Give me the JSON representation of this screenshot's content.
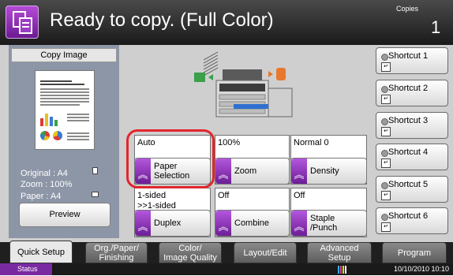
{
  "header": {
    "title": "Ready to copy. (Full Color)",
    "copies_label": "Copies",
    "copies_value": "1"
  },
  "preview_panel": {
    "title": "Copy Image",
    "original": "Original  :  A4",
    "zoom": "Zoom      :  100%",
    "paper": "Paper     :  A4",
    "preview_label": "Preview"
  },
  "functions": {
    "paper_selection": {
      "value": "Auto",
      "label": "Paper Selection"
    },
    "zoom": {
      "value": "100%",
      "label": "Zoom"
    },
    "density": {
      "value": "Normal 0",
      "label": "Density"
    },
    "duplex": {
      "value_line1": "1-sided",
      "value_line2": ">>1-sided",
      "label": "Duplex"
    },
    "combine": {
      "value": "Off",
      "label": "Combine"
    },
    "staple": {
      "value": "Off",
      "label_line1": "Staple",
      "label_line2": "/Punch"
    }
  },
  "shortcuts": [
    "Shortcut 1",
    "Shortcut 2",
    "Shortcut 3",
    "Shortcut 4",
    "Shortcut 5",
    "Shortcut 6"
  ],
  "tabs": [
    {
      "line1": "Quick Setup",
      "line2": "",
      "active": true
    },
    {
      "line1": "Org./Paper/",
      "line2": "Finishing",
      "active": false
    },
    {
      "line1": "Color/",
      "line2": "Image Quality",
      "active": false
    },
    {
      "line1": "Layout/Edit",
      "line2": "",
      "active": false
    },
    {
      "line1": "Advanced",
      "line2": "Setup",
      "active": false
    },
    {
      "line1": "Program",
      "line2": "",
      "active": false
    }
  ],
  "status": {
    "label": "Status",
    "datetime": "10/10/2010 10:10"
  },
  "colors": {
    "accent_purple": "#7a2aa1",
    "highlight_red": "#e2262d"
  },
  "icons": {
    "copy": "copy-mode-icon",
    "shortcut": "shortcut-icon",
    "chevron": "double-chevron-up-icon"
  }
}
